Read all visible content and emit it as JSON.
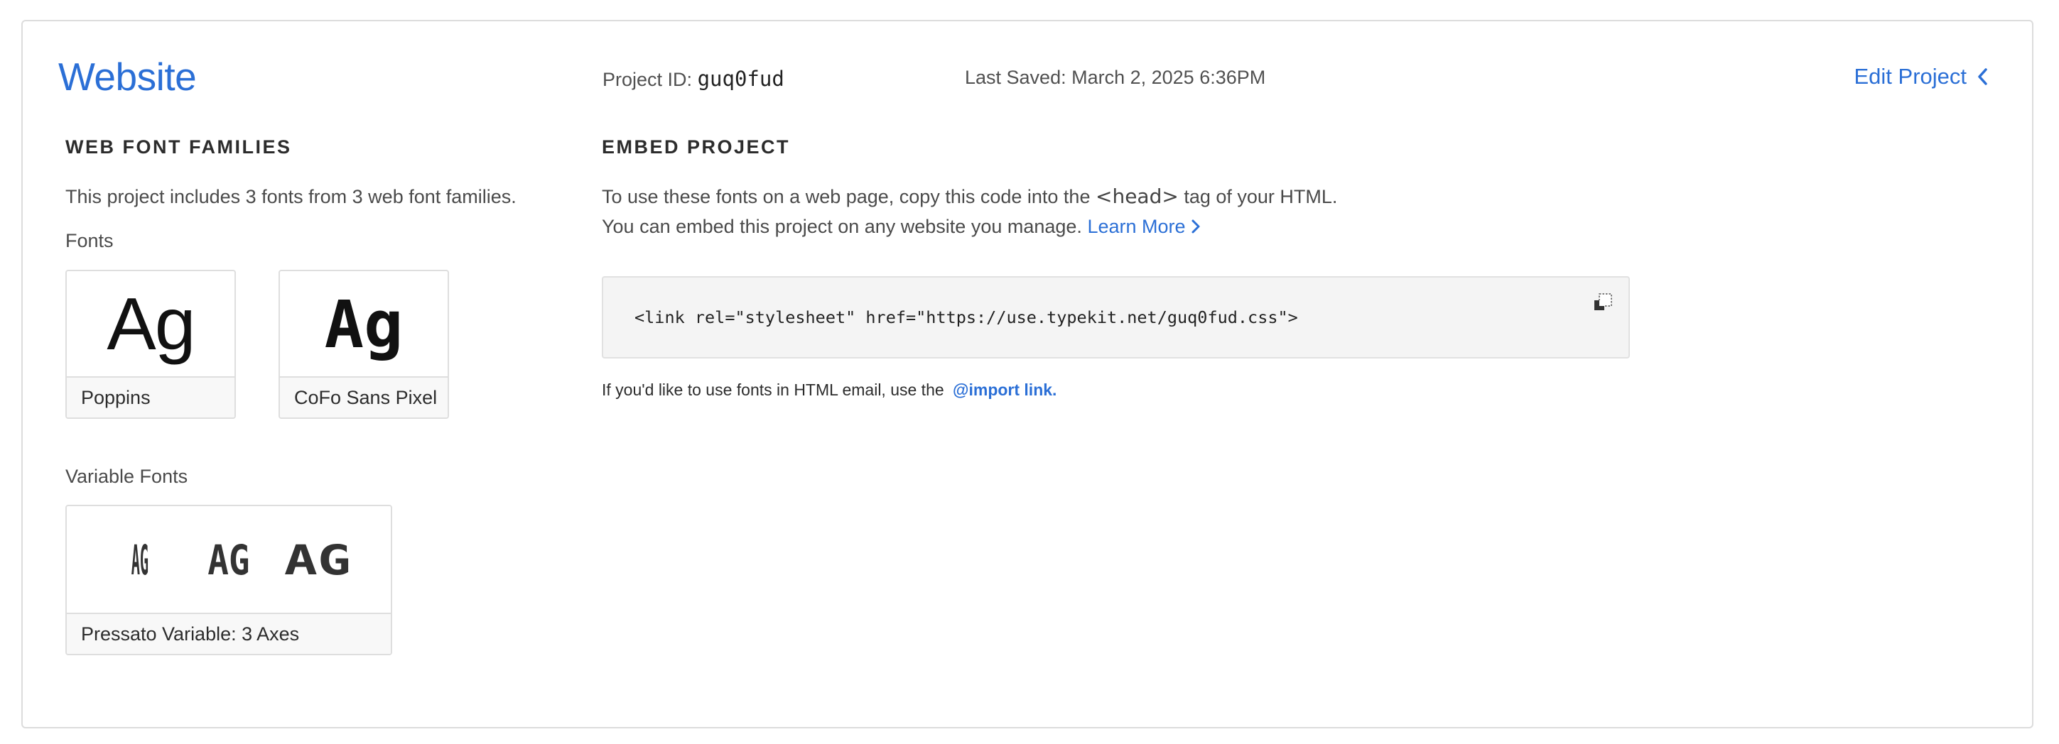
{
  "project": {
    "title": "Website",
    "id_label": "Project ID:",
    "id_value": "guq0fud",
    "last_saved": "Last Saved: March 2, 2025 6:36PM",
    "edit_label": "Edit Project"
  },
  "families": {
    "heading": "WEB FONT FAMILIES",
    "description": "This project includes 3 fonts from 3 web font families.",
    "fonts_label": "Fonts",
    "variable_label": "Variable Fonts",
    "fonts": [
      {
        "name": "Poppins",
        "sample": "Ag"
      },
      {
        "name": "CoFo Sans Pixel",
        "sample": "Ag"
      }
    ],
    "variable_fonts": [
      {
        "name": "Pressato Variable: 3 Axes",
        "samples": [
          "AG",
          "AG",
          "AG"
        ]
      }
    ]
  },
  "embed": {
    "heading": "EMBED PROJECT",
    "line1_pre": "To use these fonts on a web page, copy this code into the",
    "line1_tag": "<head>",
    "line1_post": "tag of your HTML.",
    "line2": "You can embed this project on any website you manage.",
    "learn_more": "Learn More",
    "code": "<link rel=\"stylesheet\" href=\"https://use.typekit.net/guq0fud.css\">",
    "email_note": "If you'd like to use fonts in HTML email, use the",
    "import_link": "@import link."
  },
  "icons": {
    "edit": "chevron-left-icon",
    "learn_more": "chevron-right-icon",
    "copy": "copy-icon"
  },
  "colors": {
    "accent": "#2b6fd6",
    "code_bg": "#f4f4f4",
    "border": "#dcdcdc"
  }
}
